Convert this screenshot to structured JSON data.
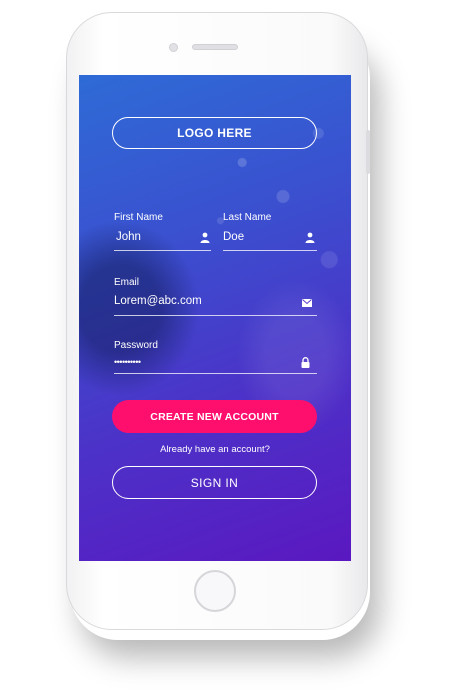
{
  "logo": {
    "label": "LOGO HERE"
  },
  "form": {
    "first_name": {
      "label": "First Name",
      "value": "John",
      "icon": "user-icon"
    },
    "last_name": {
      "label": "Last Name",
      "value": "Doe",
      "icon": "user-icon"
    },
    "email": {
      "label": "Email",
      "value": "Lorem@abc.com",
      "icon": "envelope-icon"
    },
    "password": {
      "label": "Password",
      "value": "••••••••••",
      "icon": "lock-icon"
    }
  },
  "actions": {
    "create_account_label": "CREATE NEW ACCOUNT",
    "already_text": "Already have an account?",
    "sign_in_label": "SIGN IN"
  },
  "colors": {
    "gradient_start": "#2e6bd6",
    "gradient_end": "#5a18c0",
    "primary_button": "#ff0f6d",
    "text": "#ffffff"
  }
}
